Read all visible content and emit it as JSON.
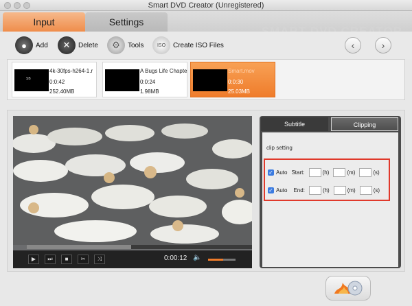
{
  "window": {
    "title": "Smart DVD Creator (Unregistered)"
  },
  "tabs": {
    "input": "Input",
    "settings": "Settings"
  },
  "brand": "SMART DVD CREATOR",
  "toolbar": {
    "add": "Add",
    "delete": "Delete",
    "tools": "Tools",
    "iso": "Create ISO Files",
    "iso_icon_text": "ISO"
  },
  "clips": [
    {
      "name": "4k-30fps-h264-1.r",
      "duration": "0:0:42",
      "size": "252.40MB"
    },
    {
      "name": "A Bugs Life Chapte",
      "duration": "0:0:24",
      "size": "1.98MB"
    },
    {
      "name": "Smart.mov",
      "duration": "0:0:30",
      "size": "25.03MB"
    }
  ],
  "player": {
    "time": "0:00:12",
    "progress": 0.46,
    "volume": 0.55
  },
  "panel": {
    "tab_subtitle": "Subtitle",
    "tab_clipping": "Clipping",
    "section": "clip setting",
    "start": {
      "auto": "Auto",
      "label": "Start:",
      "h": "(h)",
      "m": "(m)",
      "s": "(s)"
    },
    "end": {
      "auto": "Auto",
      "label": "End:",
      "h": "(h)",
      "m": "(m)",
      "s": "(s)"
    }
  }
}
